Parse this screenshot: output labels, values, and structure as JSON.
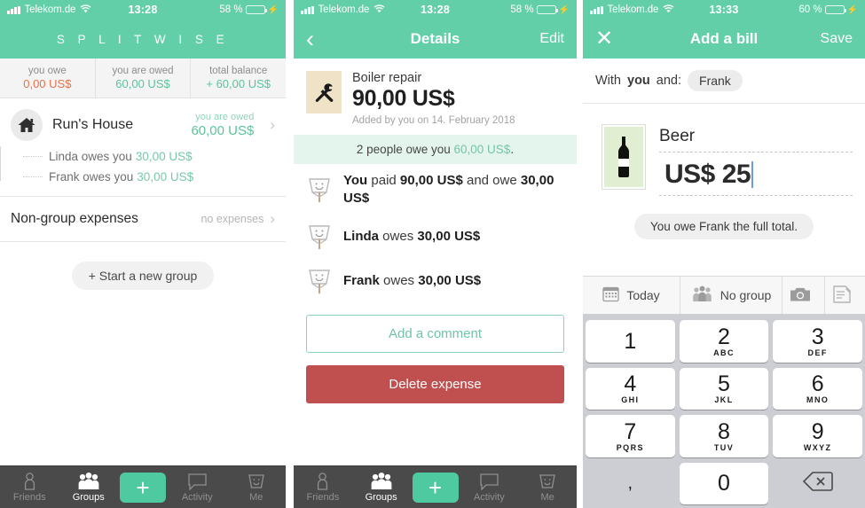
{
  "statusbars": [
    {
      "carrier": "Telekom.de",
      "time": "13:28",
      "battery": "58 %",
      "wifi": "wifi-icon"
    },
    {
      "carrier": "Telekom.de",
      "time": "13:28",
      "battery": "58 %",
      "wifi": "wifi-icon"
    },
    {
      "carrier": "Telekom.de",
      "time": "13:33",
      "battery": "60 %",
      "wifi": "wifi-icon"
    }
  ],
  "colors": {
    "brand_green": "#63cfa9",
    "accent_green": "#5bc49a",
    "owe_red": "#e8704a",
    "delete_red": "#c0504f",
    "tabbar_dark": "#4a4a4a",
    "keypad_bg": "#ccced3"
  },
  "panel1": {
    "brand": "S P L I T W I S E",
    "balances": [
      {
        "label": "you owe",
        "value": "0,00 US$",
        "tone": "red"
      },
      {
        "label": "you are owed",
        "value": "60,00 US$",
        "tone": "green"
      },
      {
        "label": "total balance",
        "value": "+ 60,00 US$",
        "tone": "green"
      }
    ],
    "group": {
      "icon": "home-icon",
      "name": "Run's House",
      "right_label": "you are owed",
      "right_value": "60,00 US$",
      "members": [
        {
          "text": "Linda owes you",
          "amount": "30,00 US$"
        },
        {
          "text": "Frank owes you",
          "amount": "30,00 US$"
        }
      ]
    },
    "nongroup": {
      "label": "Non-group expenses",
      "value": "no expenses"
    },
    "new_group_button": "+ Start a new group"
  },
  "panel2": {
    "nav": {
      "back": "back-chevron",
      "title": "Details",
      "right": "Edit"
    },
    "expense": {
      "icon": "tools-icon",
      "title": "Boiler repair",
      "amount": "90,00 US$",
      "meta": "Added by you on 14. February 2018"
    },
    "owe_banner": {
      "prefix": "2 people owe you",
      "amount": "60,00 US$",
      "suffix": "."
    },
    "people": [
      {
        "name": "You",
        "verb": "paid",
        "amount": "90,00 US$",
        "extra": "and owe",
        "extra_amount": "30,00 US$"
      },
      {
        "name": "Linda",
        "verb": "owes",
        "amount": "30,00 US$"
      },
      {
        "name": "Frank",
        "verb": "owes",
        "amount": "30,00 US$"
      }
    ],
    "comment_button": "Add a comment",
    "delete_button": "Delete expense"
  },
  "panel3": {
    "nav": {
      "close": "close-icon",
      "title": "Add a bill",
      "right": "Save"
    },
    "with_row": {
      "prefix": "With",
      "you": "you",
      "and": "and:",
      "chip": "Frank"
    },
    "bill": {
      "icon": "beer-bottle-icon",
      "description": "Beer",
      "amount": "US$ 25",
      "split_note": "You owe Frank the full total."
    },
    "options": [
      {
        "icon": "calendar-icon",
        "label": "Today"
      },
      {
        "icon": "group-icon",
        "label": "No group"
      },
      {
        "icon": "camera-icon",
        "label": ""
      },
      {
        "icon": "note-icon",
        "label": ""
      }
    ],
    "keypad": [
      {
        "num": "1",
        "sub": ""
      },
      {
        "num": "2",
        "sub": "ABC"
      },
      {
        "num": "3",
        "sub": "DEF"
      },
      {
        "num": "4",
        "sub": "GHI"
      },
      {
        "num": "5",
        "sub": "JKL"
      },
      {
        "num": "6",
        "sub": "MNO"
      },
      {
        "num": "7",
        "sub": "PQRS"
      },
      {
        "num": "8",
        "sub": "TUV"
      },
      {
        "num": "9",
        "sub": "WXYZ"
      },
      {
        "num": ",",
        "sub": ""
      },
      {
        "num": "0",
        "sub": ""
      },
      {
        "num": "delete-icon",
        "sub": ""
      }
    ]
  },
  "tabbar": {
    "items": [
      {
        "label": "Friends",
        "icon": "person-icon",
        "active": false
      },
      {
        "label": "Groups",
        "icon": "people-icon",
        "active": true
      },
      {
        "label": "Activity",
        "icon": "speech-bubble-icon",
        "active": false
      },
      {
        "label": "Me",
        "icon": "face-cup-icon",
        "active": false
      }
    ],
    "add_label": "+"
  }
}
